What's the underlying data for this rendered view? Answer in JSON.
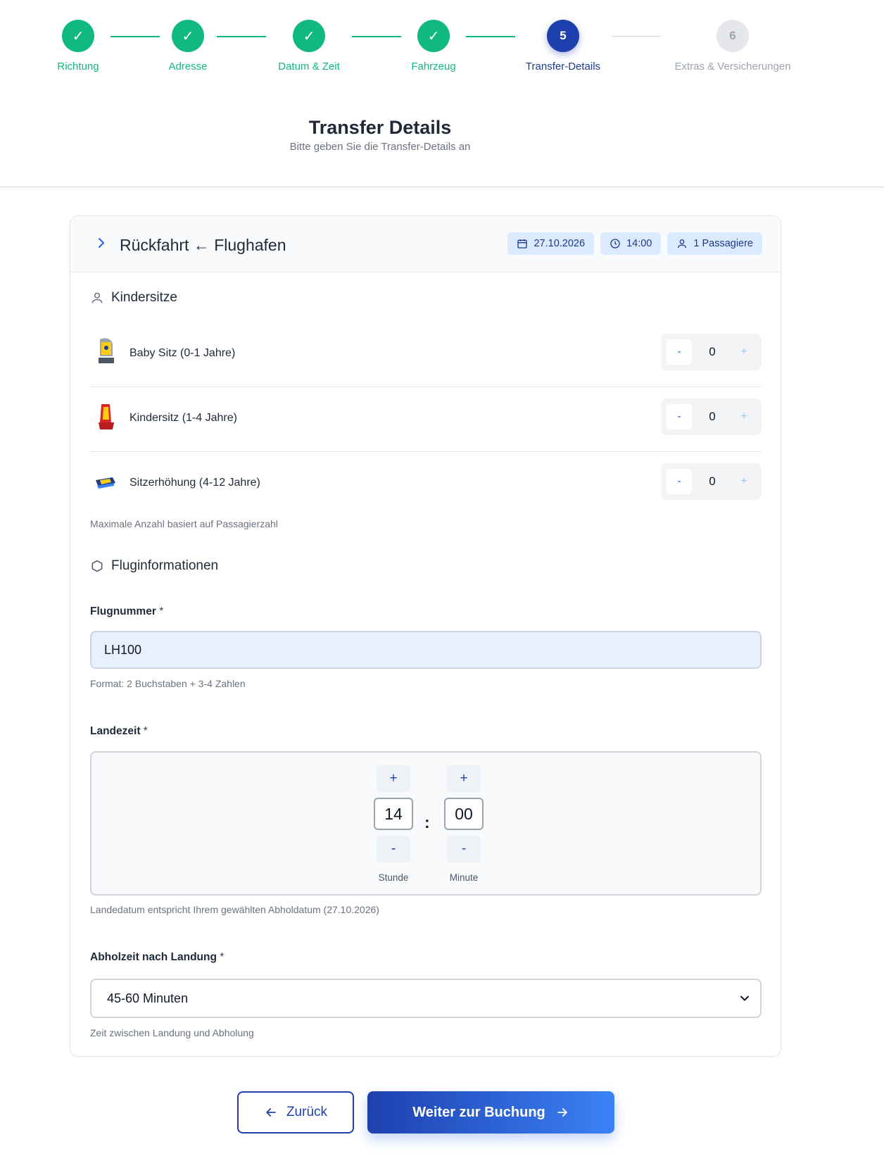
{
  "steps": [
    {
      "label": "Richtung",
      "status": "done",
      "marker": "✓"
    },
    {
      "label": "Adresse",
      "status": "done",
      "marker": "✓"
    },
    {
      "label": "Datum & Zeit",
      "status": "done",
      "marker": "✓"
    },
    {
      "label": "Fahrzeug",
      "status": "done",
      "marker": "✓"
    },
    {
      "label": "Transfer-Details",
      "status": "active",
      "marker": "5"
    },
    {
      "label": "Extras & Versicherungen",
      "status": "todo",
      "marker": "6"
    }
  ],
  "page": {
    "title": "Transfer Details",
    "subtitle": "Bitte geben Sie die Transfer-Details an"
  },
  "trip": {
    "route": "Rückfahrt ← Flughafen",
    "date": "27.10.2026",
    "time": "14:00",
    "passengers": "1 Passagiere"
  },
  "child_seats": {
    "title": "Kindersitze",
    "items": [
      {
        "label": "Baby Sitz (0-1 Jahre)",
        "count": "0",
        "minus": "-",
        "plus": "+"
      },
      {
        "label": "Kindersitz (1-4 Jahre)",
        "count": "0",
        "minus": "-",
        "plus": "+"
      },
      {
        "label": "Sitzerhöhung (4-12 Jahre)",
        "count": "0",
        "minus": "-",
        "plus": "+"
      }
    ],
    "hint": "Maximale Anzahl basiert auf Passagierzahl"
  },
  "flight": {
    "title": "Fluginformationen",
    "number_label": "Flugnummer",
    "number_value": "LH100",
    "number_hint": "Format: 2 Buchstaben + 3-4 Zahlen",
    "landing_label": "Landezeit",
    "hour": "14",
    "minute": "00",
    "separator": ":",
    "hour_caption": "Stunde",
    "minute_caption": "Minute",
    "plus": "+",
    "minus": "-",
    "landing_hint": "Landedatum entspricht Ihrem gewählten Abholdatum (27.10.2026)",
    "pickup_label": "Abholzeit nach Landung",
    "pickup_value": "45-60 Minuten",
    "pickup_hint": "Zeit zwischen Landung und Abholung",
    "required_mark": "*"
  },
  "actions": {
    "back": "Zurück",
    "next": "Weiter zur Buchung"
  },
  "colors": {
    "done": "#10b981",
    "active": "#1e40af",
    "badge_bg": "#dbeafe"
  }
}
